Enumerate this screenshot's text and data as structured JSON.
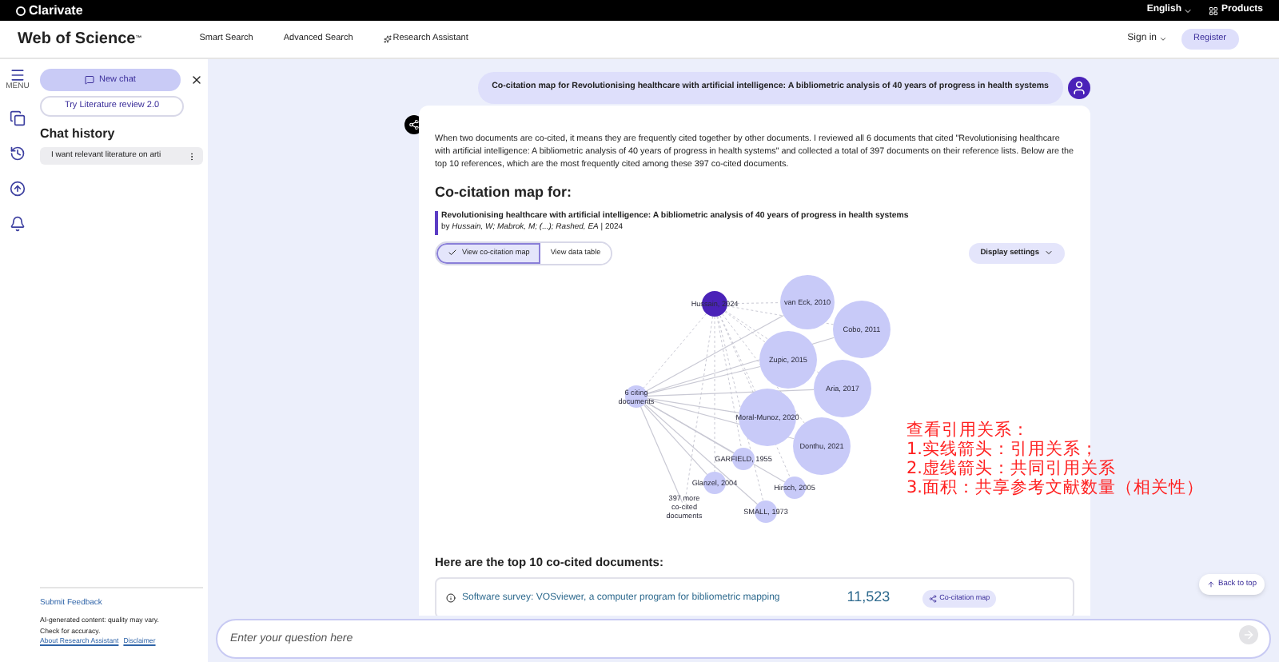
{
  "top_bar": {
    "brand": "Clarivate",
    "language": "English",
    "products": "Products"
  },
  "header": {
    "logo": "Web of Science",
    "logo_mark": "™",
    "nav": [
      {
        "label": "Smart Search"
      },
      {
        "label": "Advanced Search"
      },
      {
        "label": "Research Assistant"
      }
    ],
    "sign_in": "Sign in",
    "register": "Register"
  },
  "icon_rail": {
    "menu_label": "MENU"
  },
  "sidebar": {
    "new_chat": "New chat",
    "literature_review": "Try Literature review 2.0",
    "history_title": "Chat history",
    "history_items": [
      {
        "text": "I want relevant literature on arti"
      }
    ],
    "feedback": "Submit Feedback",
    "disclaimer_text": "AI-generated content: quality may vary. Check for accuracy.",
    "links": [
      "About Research Assistant",
      "Disclaimer"
    ]
  },
  "conversation": {
    "user_message": "Co-citation map for Revolutionising healthcare with artificial intelligence: A bibliometric analysis of 40 years of progress in health systems",
    "answer": {
      "intro": "When two documents are co-cited, it means they are frequently cited together by other documents. I reviewed all 6 documents that cited \"Revolutionising healthcare with artificial intelligence: A bibliometric analysis of 40 years of progress in health systems\" and collected a total of 397 documents on their reference lists. Below are the top 10 references, which are the most frequently cited among these 397 co-cited documents.",
      "map_heading": "Co-citation map for:",
      "paper_title": "Revolutionising healthcare with artificial intelligence: A bibliometric analysis of 40 years of progress in health systems",
      "paper_byline": "by *Hussain, W; Mabrok, M; (...); Rashed, EA* | 2024",
      "views": [
        {
          "label": "View co-citation map",
          "selected": true
        },
        {
          "label": "View data table",
          "selected": false
        }
      ],
      "display_settings": "Display settings",
      "nodes": [
        {
          "kind": "source",
          "label": [
            "Hussain, 2024"
          ]
        },
        {
          "kind": "cited",
          "label": [
            "van Eck, 2010"
          ]
        },
        {
          "kind": "cited",
          "label": [
            "Cobo, 2011"
          ]
        },
        {
          "kind": "cited",
          "label": [
            "Zupic, 2015"
          ]
        },
        {
          "kind": "cited",
          "label": [
            "Aria, 2017"
          ]
        },
        {
          "kind": "cited",
          "label": [
            "Moral-Munoz, 2020"
          ]
        },
        {
          "kind": "cited",
          "label": [
            "Donthu, 2021"
          ]
        },
        {
          "kind": "citing",
          "label": [
            "6 citing",
            "documents"
          ]
        },
        {
          "kind": "cited",
          "label": [
            "GARFIELD, 1955"
          ]
        },
        {
          "kind": "cited",
          "label": [
            "Glanzel, 2004"
          ]
        },
        {
          "kind": "cited",
          "label": [
            "Hirsch, 2005"
          ]
        },
        {
          "kind": "cited",
          "label": [
            "SMALL, 1973"
          ]
        },
        {
          "kind": "more",
          "label": [
            "397 more",
            "co-cited",
            "documents"
          ]
        }
      ],
      "top_heading": "Here are the top 10 co-cited documents:",
      "documents": [
        {
          "title": "Software survey: VOSviewer, a computer program for bibliometric mapping",
          "count": "11,523",
          "action": "Co-citation map"
        }
      ]
    }
  },
  "annotation": [
    "查看引用关系：",
    "1.实线箭头：引用关系；",
    "2.虚线箭头：共同引用关系",
    "3.面积：共享参考文献数量（相关性）"
  ],
  "input": {
    "placeholder": "Enter your question here"
  },
  "back_to_top": "Back to top"
}
